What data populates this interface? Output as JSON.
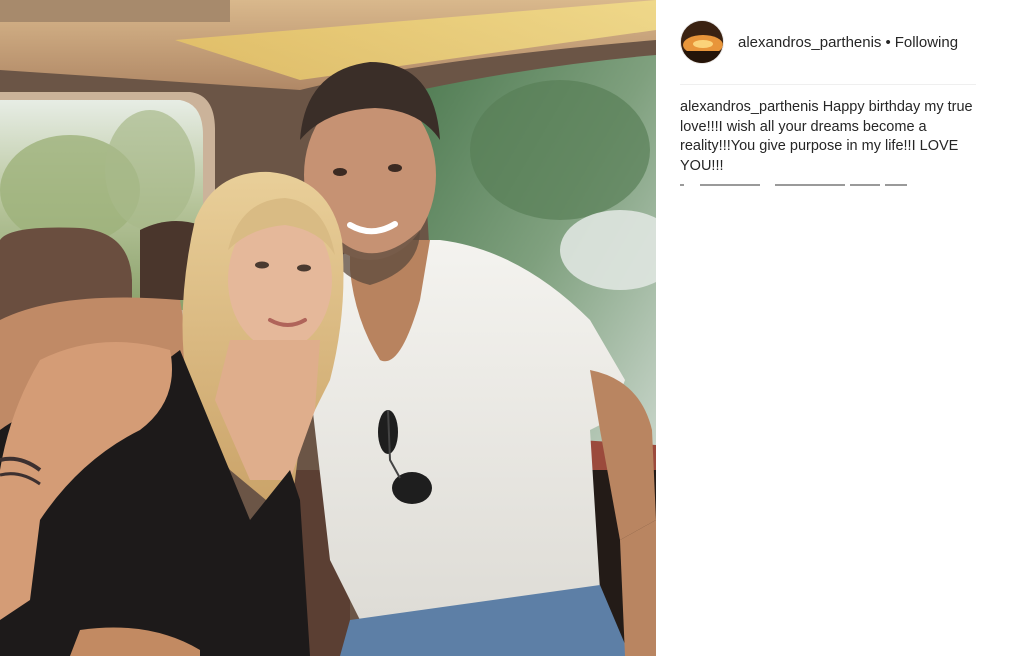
{
  "post": {
    "username": "alexandros_parthenis",
    "separator": "•",
    "follow_state": "Following",
    "caption": {
      "username": "alexandros_parthenis",
      "text": "Happy birthday my true love!!!I wish all your dreams become a reality!!!You give purpose in my life!!I LOVE YOU!!!"
    }
  },
  "icons": {
    "avatar": "profile-avatar-sunset"
  },
  "colors": {
    "text": "#262626",
    "divider": "#efefef",
    "background": "#ffffff"
  }
}
